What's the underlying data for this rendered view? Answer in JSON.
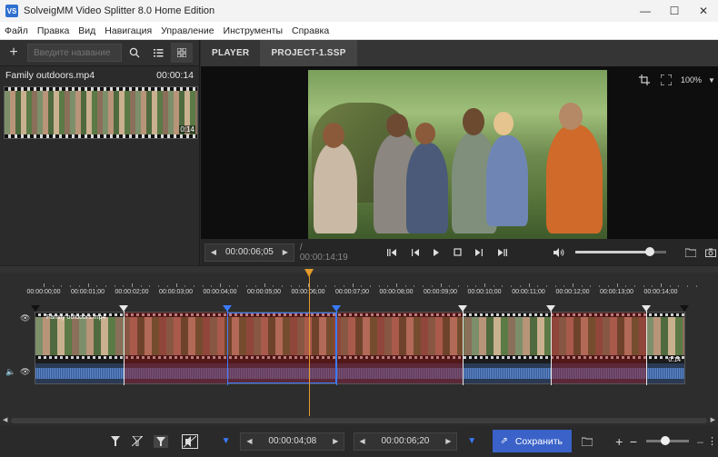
{
  "window": {
    "title": "SolveigMM Video Splitter 8.0 Home Edition",
    "app_icon": "VS",
    "minimize": "—",
    "maximize": "☐",
    "close": "✕"
  },
  "menu": [
    "Файл",
    "Правка",
    "Вид",
    "Навигация",
    "Управление",
    "Инструменты",
    "Справка"
  ],
  "left_panel": {
    "add": "+",
    "search_placeholder": "Введите название",
    "file_name": "Family outdoors.mp4",
    "file_duration": "00:00:14",
    "thumb_time": "0:14"
  },
  "tabs": [
    "PLAYER",
    "PROJECT-1.SSP"
  ],
  "player": {
    "zoom": "100%",
    "current_time": "00:00:06;05",
    "total_time": "/ 00:00:14;19",
    "volume": 0.82
  },
  "timeline": {
    "ticks": [
      "00:00:00;00",
      "00:00:01;00",
      "00:00:02;00",
      "00:00:03;00",
      "00:00:04;00",
      "00:00:05;00",
      "00:00:06;00",
      "00:00:07;00",
      "00:00:08;00",
      "00:00:09;00",
      "00:00:10;00",
      "00:00:11;00",
      "00:00:12;00",
      "00:00:13;00",
      "00:00:14;00"
    ],
    "track_label": "Family outdoors.mp4",
    "track_time": "0:14"
  },
  "bottom": {
    "marker_in_time": "00:00:04;08",
    "marker_out_time": "00:00:06;20",
    "save_label": "Сохранить",
    "zoom_level": 0.45
  }
}
